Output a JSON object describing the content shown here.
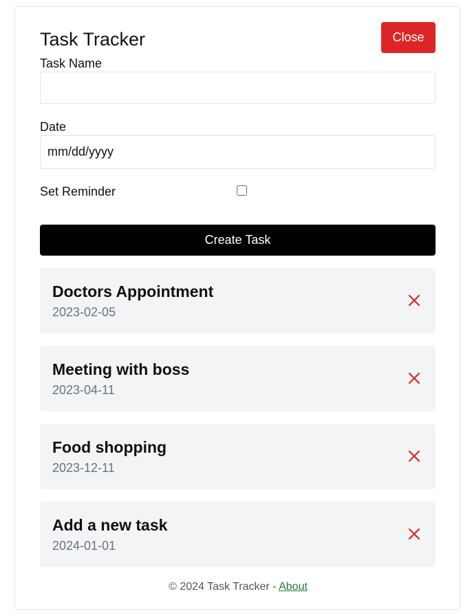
{
  "header": {
    "title": "Task Tracker",
    "close_label": "Close"
  },
  "form": {
    "task_name_label": "Task Name",
    "task_name_value": "",
    "date_label": "Date",
    "date_placeholder": "mm/dd/yyyy",
    "reminder_label": "Set Reminder",
    "reminder_checked": false,
    "submit_label": "Create Task"
  },
  "tasks": [
    {
      "name": "Doctors Appointment",
      "date": "2023-02-05"
    },
    {
      "name": "Meeting with boss",
      "date": "2023-04-11"
    },
    {
      "name": "Food shopping",
      "date": "2023-12-11"
    },
    {
      "name": "Add a new task",
      "date": "2024-01-01"
    }
  ],
  "footer": {
    "copyright": "© 2024 Task Tracker - ",
    "about_label": "About"
  },
  "colors": {
    "close_button": "#dc2626",
    "create_button": "#000000",
    "delete_icon": "#dc2626",
    "task_background": "#f3f4f6",
    "about_link": "#1f7a3a"
  }
}
